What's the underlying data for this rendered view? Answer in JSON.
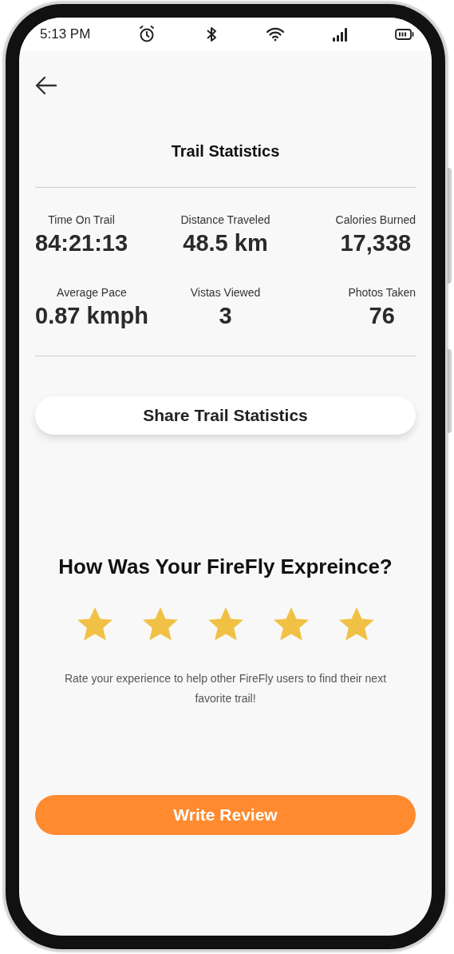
{
  "status_bar": {
    "time": "5:13 PM"
  },
  "header": {
    "title": "Trail Statistics"
  },
  "stats": [
    {
      "label": "Time On Trail",
      "value": "84:21:13"
    },
    {
      "label": "Distance Traveled",
      "value": "48.5 km"
    },
    {
      "label": "Calories Burned",
      "value": "17,338"
    },
    {
      "label": "Average Pace",
      "value": "0.87 kmph"
    },
    {
      "label": "Vistas Viewed",
      "value": "3"
    },
    {
      "label": "Photos Taken",
      "value": "76"
    }
  ],
  "share_button": "Share Trail Statistics",
  "rating": {
    "question": "How Was Your FireFly Expreince?",
    "stars": 5,
    "hint": "Rate your experience to help other FireFly users to find their next favorite trail!"
  },
  "review_button": "Write Review"
}
